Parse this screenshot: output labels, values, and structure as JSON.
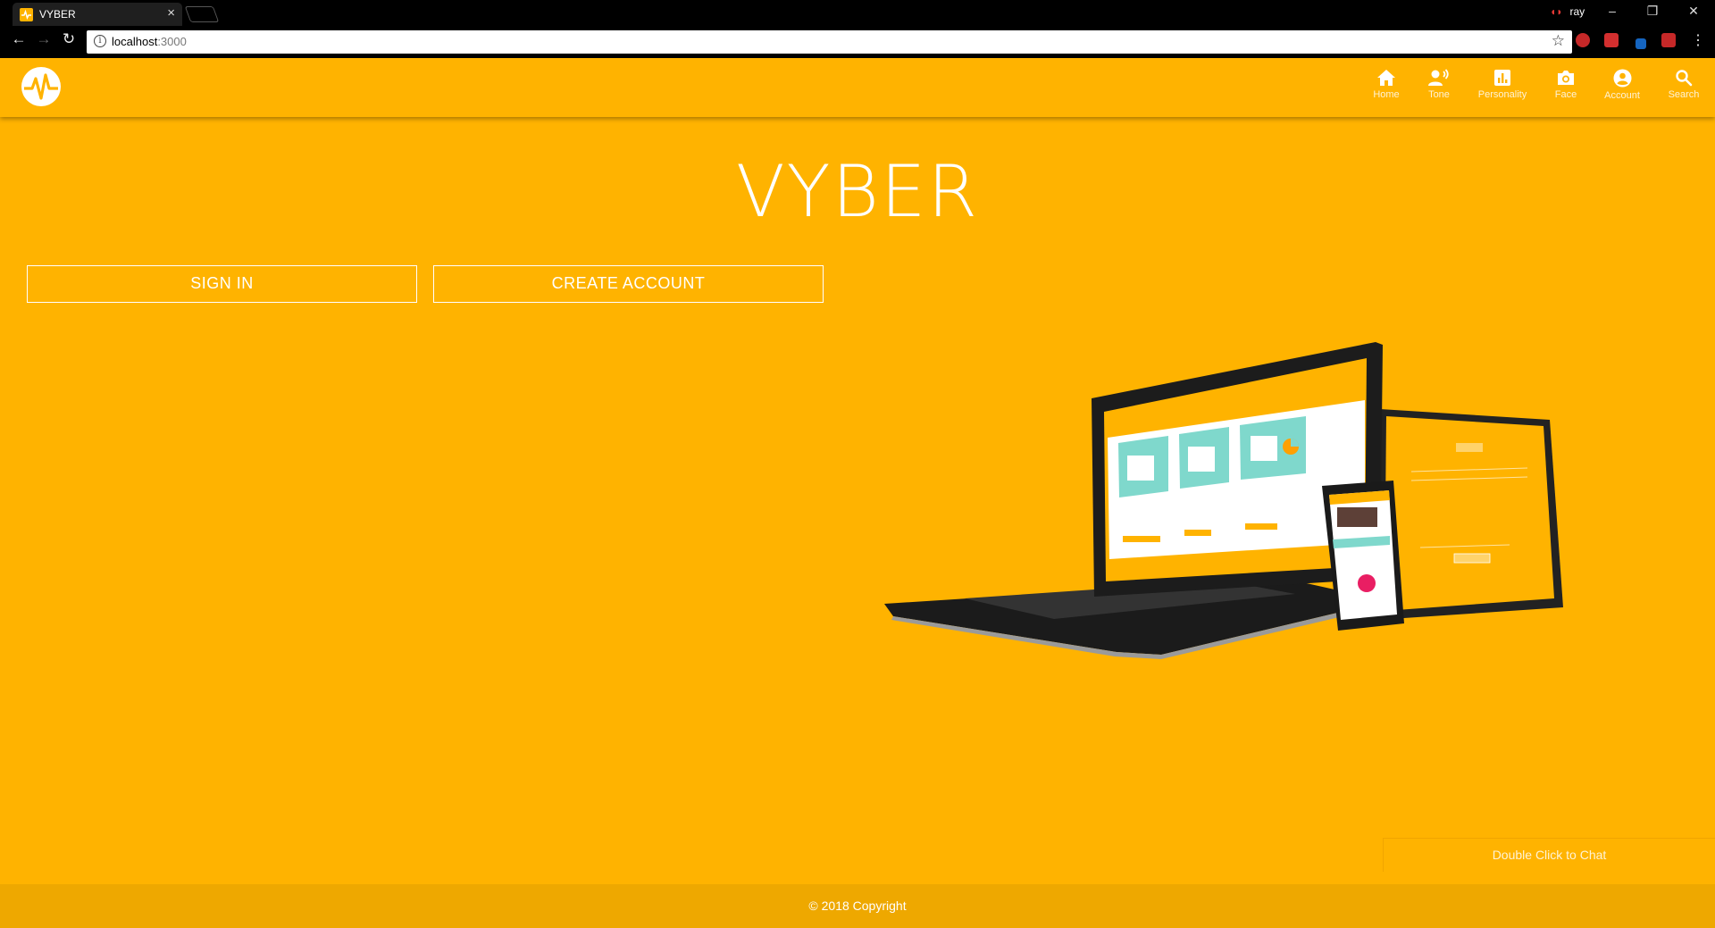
{
  "browser": {
    "tab_title": "VYBER",
    "url_host": "localhost",
    "url_port": ":3000",
    "profile_name": "ray"
  },
  "header": {
    "nav": [
      {
        "label": "Home",
        "icon": "home-icon"
      },
      {
        "label": "Tone",
        "icon": "tone-icon"
      },
      {
        "label": "Personality",
        "icon": "personality-icon"
      },
      {
        "label": "Face",
        "icon": "camera-icon"
      },
      {
        "label": "Account",
        "icon": "account-icon"
      },
      {
        "label": "Search",
        "icon": "search-icon"
      }
    ]
  },
  "main": {
    "title": "VYBER",
    "signin_label": "SIGN IN",
    "create_account_label": "CREATE ACCOUNT"
  },
  "chat": {
    "label": "Double Click to Chat"
  },
  "footer": {
    "copyright": "© 2018 Copyright"
  },
  "colors": {
    "brand": "#FFB300",
    "footer": "#EEA800",
    "mint": "#7FD8CC"
  }
}
